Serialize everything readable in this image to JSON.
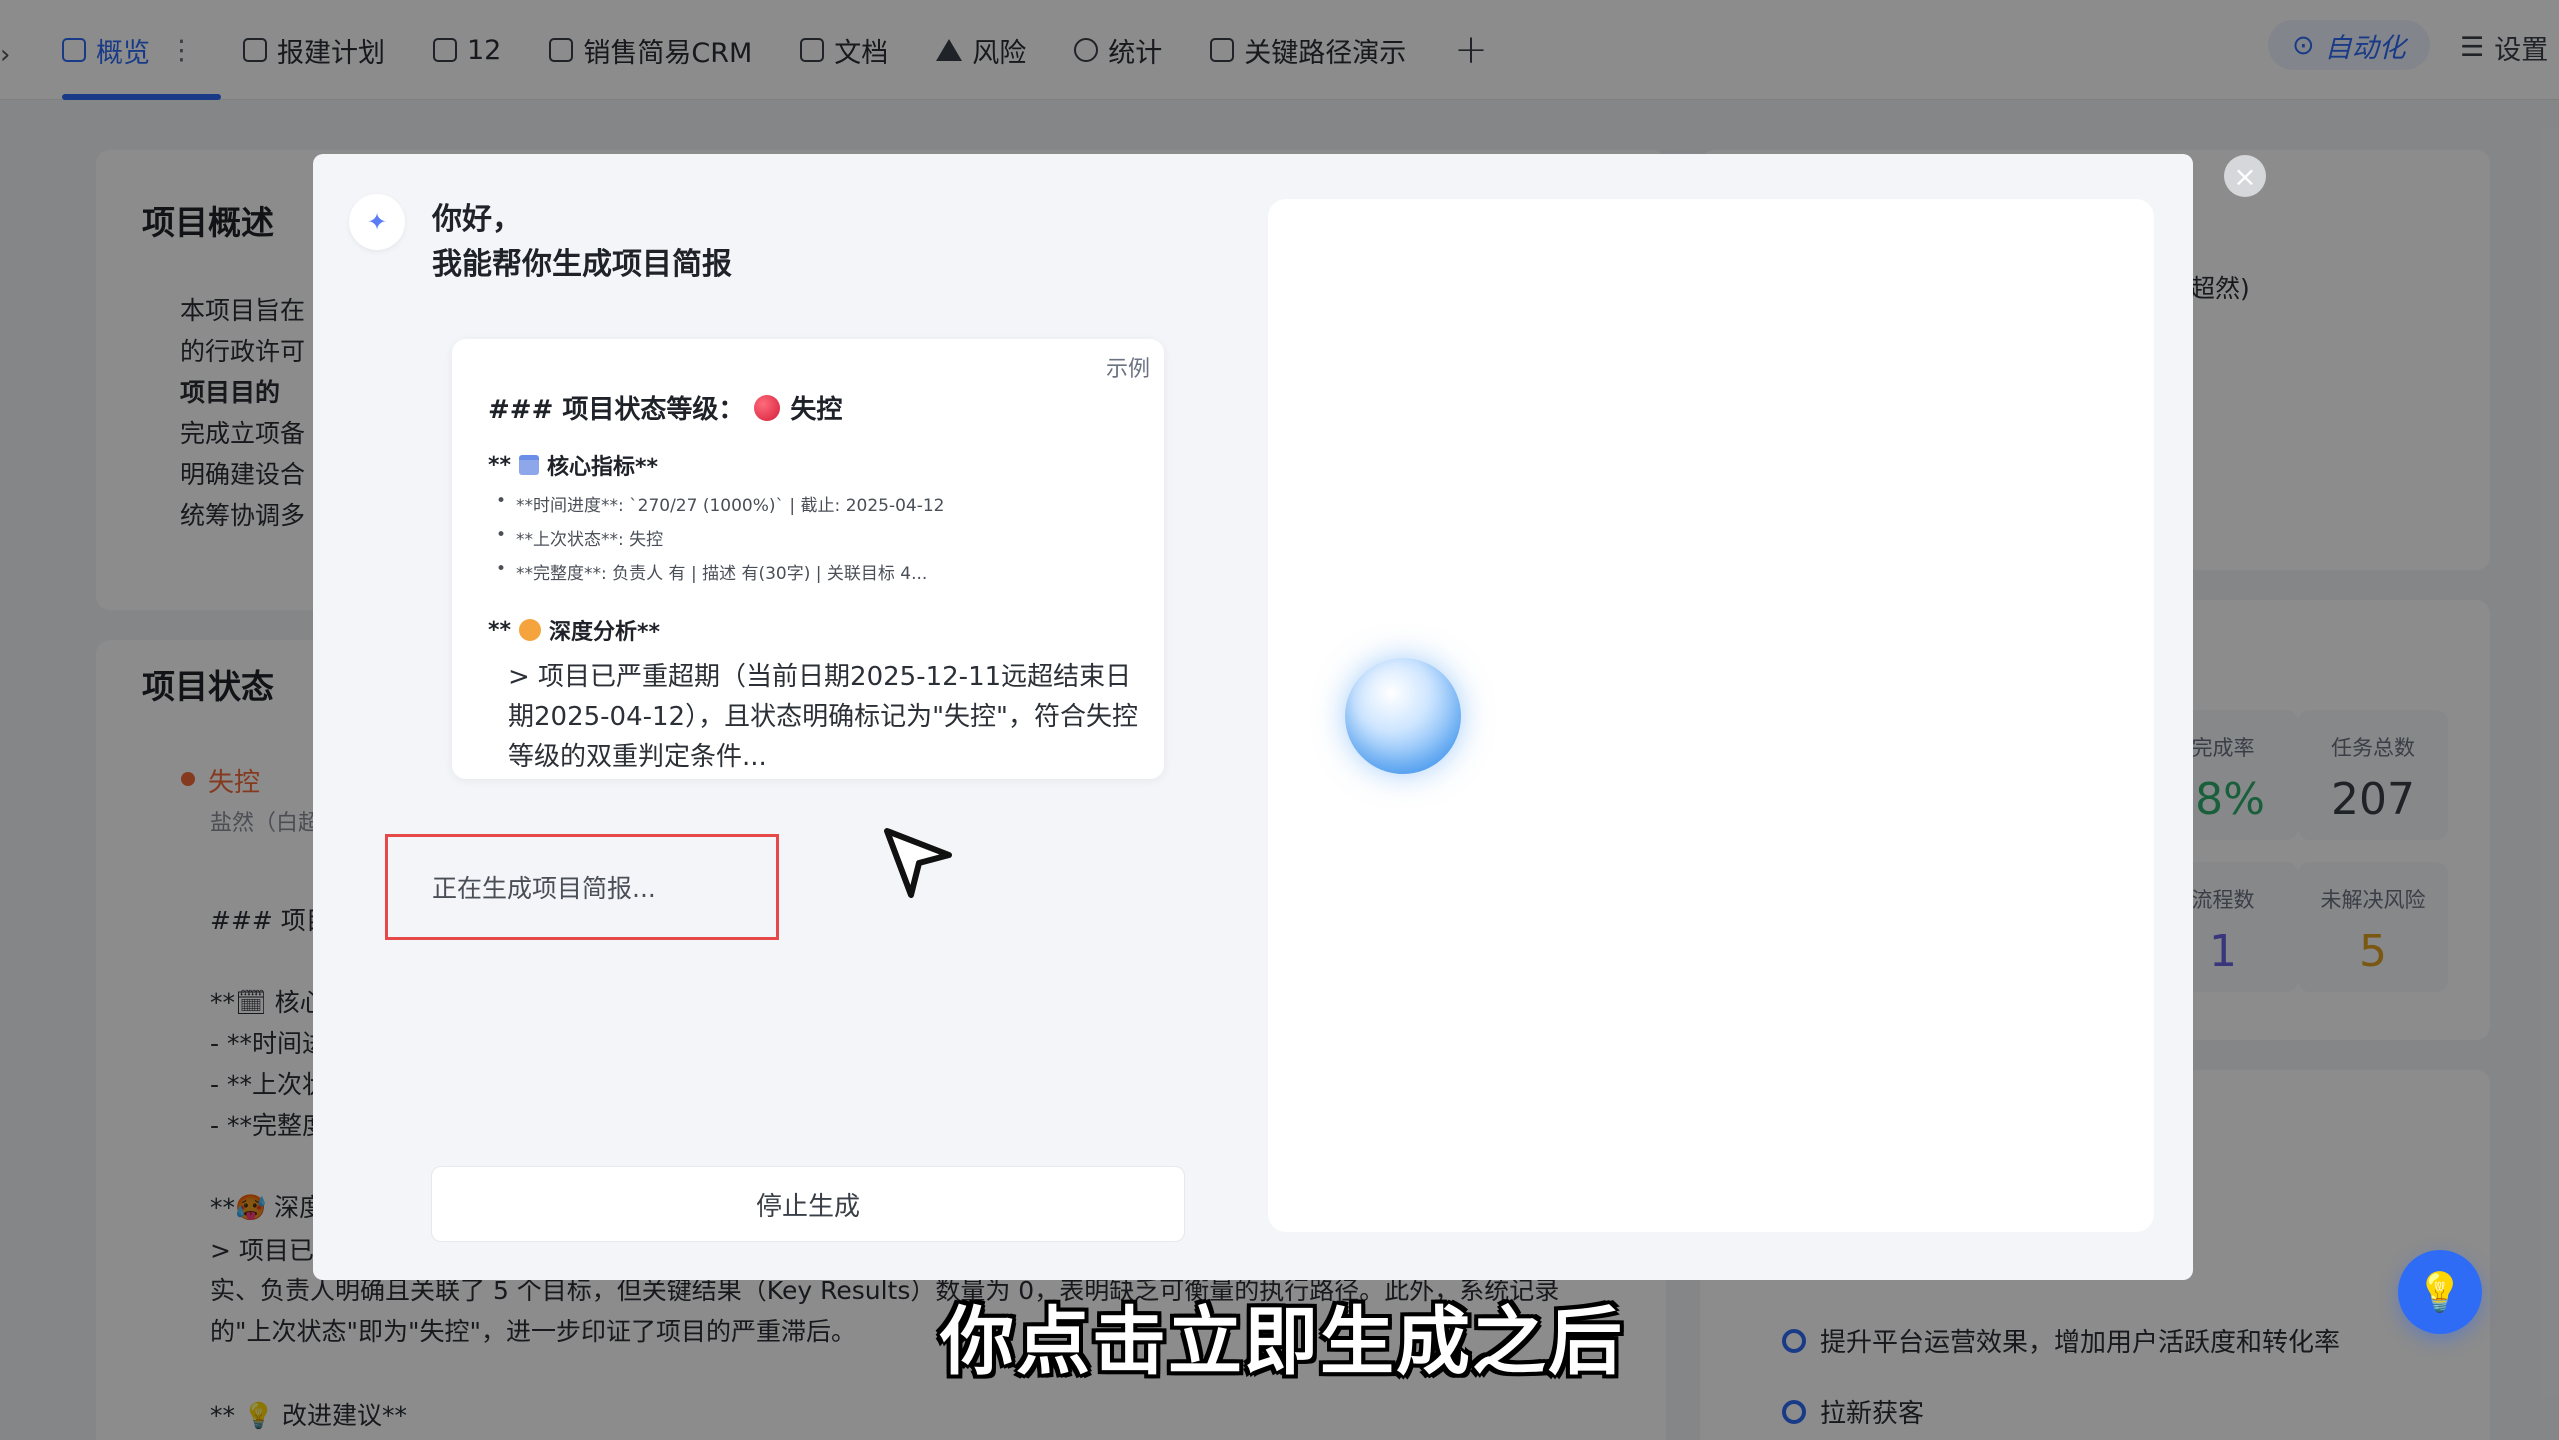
{
  "tabs": [
    {
      "label": "概览",
      "icon": "chart-icon",
      "active": true
    },
    {
      "label": "报建计划",
      "icon": "grid-icon"
    },
    {
      "label": "12",
      "icon": "doc-icon"
    },
    {
      "label": "销售简易CRM",
      "icon": "doc-icon"
    },
    {
      "label": "文档",
      "icon": "file-icon"
    },
    {
      "label": "风险",
      "icon": "warning-icon"
    },
    {
      "label": "统计",
      "icon": "pie-icon"
    },
    {
      "label": "关键路径演示",
      "icon": "grid-icon"
    }
  ],
  "tab_more": "⋮",
  "tab_add": "+",
  "automation_label": "自动化",
  "settings_label": "设置",
  "background": {
    "overview_title": "项目概述",
    "overview_lines": [
      "本项目旨在",
      "的行政许可",
      "项目目的",
      "完成立项备",
      "明确建设合",
      "统筹协调多"
    ],
    "status_title": "项目状态",
    "status_value": "失控",
    "status_owner": "盐然（白超",
    "md_lines": [
      "### 项目",
      "**🗓 核心",
      "- **时间进",
      "- **上次状",
      "- **完整度",
      "**🥵 深度",
      "> 项目已"
    ],
    "md_para1": "实、负责人明确且关联了 5 个目标，但关键结果（Key Results）数量为 0，表明缺乏可衡量的执行路径。此外，系统记录",
    "md_para2": "的\"上次状态\"即为\"失控\"，进一步印证了项目的严重滞后。",
    "md_suggest": "** 💡 改进建议**",
    "right_owner_suffix": "超然)",
    "stats": [
      {
        "label": "完成率",
        "value": ".8%",
        "color": "#2fae6e"
      },
      {
        "label": "任务总数",
        "value": "207",
        "color": "#3a3f47"
      },
      {
        "label": "流程数",
        "value": "1",
        "color": "#6b63e0"
      },
      {
        "label": "未解决风险",
        "value": "5",
        "color": "#e0a020"
      }
    ],
    "goals": [
      "提升平台运营效果，增加用户活跃度和转化率",
      "拉新获客"
    ]
  },
  "modal": {
    "greeting_line1": "你好，",
    "greeting_line2": "我能帮你生成项目简报",
    "example": {
      "tag": "示例",
      "heading": "### 项目状态等级：",
      "heading_value": "失控",
      "metrics_title_prefix": "**",
      "metrics_title": "核心指标**",
      "metrics": [
        "**时间进度**: `270/27 (1000%)` | 截止: 2025-04-12",
        "**上次状态**: 失控",
        "**完整度**: 负责人 有 | 描述 有(30字) | 关联目标 4..."
      ],
      "analysis_title_prefix": "**",
      "analysis_title": "深度分析**",
      "analysis_text": "> 项目已严重超期（当前日期2025-12-11远超结束日期2025-04-12），且状态明确标记为\"失控\"，符合失控等级的双重判定条件..."
    },
    "generating_text": "正在生成项目简报...",
    "stop_button": "停止生成",
    "close_icon": "×"
  },
  "subtitle": "你点击立即生成之后"
}
